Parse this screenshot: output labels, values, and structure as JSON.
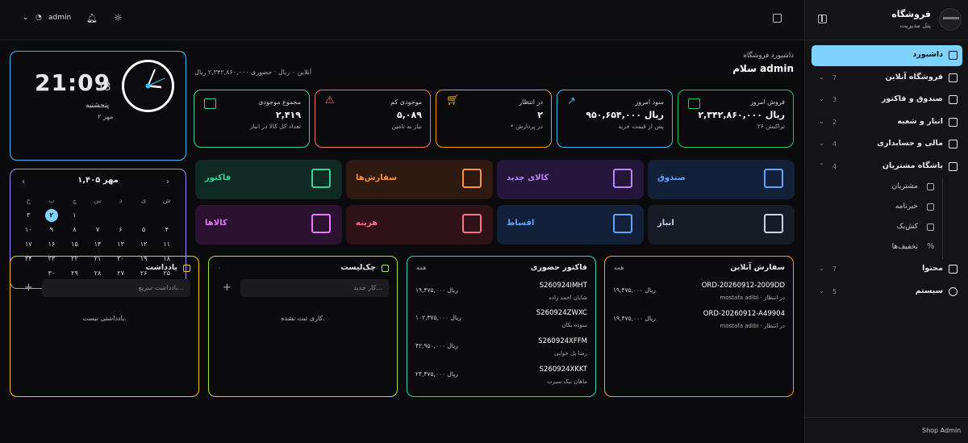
{
  "topbar": {
    "user": "admin"
  },
  "sidebar": {
    "title": "فروشگاه",
    "subtitle": "پنل مدیریت",
    "items": [
      {
        "label": "داشبورد",
        "count": "",
        "active": true
      },
      {
        "label": "فروشگاه آنلاین",
        "count": "7"
      },
      {
        "label": "صندوق و فاکتور",
        "count": "3"
      },
      {
        "label": "انبار و شعبه",
        "count": "2"
      },
      {
        "label": "مالی و حسابداری",
        "count": "4"
      },
      {
        "label": "باشگاه مشتریان",
        "count": "4"
      }
    ],
    "subitems": [
      "مشتریان",
      "خبرنامه",
      "کش‌بک",
      "تخفیف‌ها"
    ],
    "bottom_items": [
      {
        "label": "محتوا",
        "count": "7"
      },
      {
        "label": "سیستم",
        "count": "5"
      }
    ],
    "footer": "Shop Admin"
  },
  "clock": {
    "time": "21:09",
    "seconds": "13",
    "weekday": "پنجشنبه",
    "date": "۲ مهر"
  },
  "calendar": {
    "title": "مهر ۱,۴۰۵",
    "weekdays": [
      "ش",
      "ی",
      "د",
      "س",
      "چ",
      "پ",
      "ج"
    ],
    "days": [
      "",
      "",
      "",
      "",
      "۱",
      "۲",
      "۳",
      "۴",
      "۵",
      "۶",
      "۷",
      "۸",
      "۹",
      "۱۰",
      "۱۱",
      "۱۲",
      "۱۳",
      "۱۴",
      "۱۵",
      "۱۶",
      "۱۷",
      "۱۸",
      "۱۹",
      "۲۰",
      "۲۱",
      "۲۲",
      "۲۳",
      "۲۴",
      "۲۵",
      "۲۶",
      "۲۷",
      "۲۸",
      "۲۹",
      "۳۰",
      ""
    ],
    "today": "۲"
  },
  "header": {
    "breadcrumb": "داشبورد فروشگاه",
    "greeting": "سلام admin",
    "sales_line": "آنلاین ۰ ریال · حضوری ۲,۳۴۲,۸۶۰,۰۰۰ ریال"
  },
  "stats": [
    {
      "title": "فروش امروز",
      "value": "۲,۳۴۲,۸۶۰,۰۰۰ ریال",
      "sub": "۲۶ تراکنش",
      "color": "#22c55e"
    },
    {
      "title": "سود امروز",
      "value": "۹۵۰,۶۵۴,۰۰۰ ریال",
      "sub": "پس از قیمت خرید",
      "color": "#38bdf8"
    },
    {
      "title": "در انتظار",
      "value": "۲",
      "sub": "• در پردازش",
      "color": "#f59e0b"
    },
    {
      "title": "موجودی کم",
      "value": "۵,۰۸۹",
      "sub": "نیاز به تامین",
      "color": "#f87171"
    },
    {
      "title": "مجموع موجودی",
      "value": "۲,۴۱۹",
      "sub": "تعداد کل کالا در انبار",
      "color": "#34d399"
    }
  ],
  "tiles": [
    {
      "label": "صندوق",
      "color": "#60a5fa",
      "bg": "#12203a"
    },
    {
      "label": "کالای جدید",
      "color": "#c084fc",
      "bg": "#24163a"
    },
    {
      "label": "سفارش‌ها",
      "color": "#fb923c",
      "bg": "#2e1a10"
    },
    {
      "label": "فاکتور",
      "color": "#34d399",
      "bg": "#0e2a22"
    },
    {
      "label": "انبار",
      "color": "#cbd5e1",
      "bg": "#161b26"
    },
    {
      "label": "اقساط",
      "color": "#60a5fa",
      "bg": "#12203a"
    },
    {
      "label": "هزینه",
      "color": "#fb7185",
      "bg": "#2e1218"
    },
    {
      "label": "کالاها",
      "color": "#e879f9",
      "bg": "#2a1230"
    }
  ],
  "online_orders": {
    "title": "سفارش آنلاین",
    "all": "همه",
    "rows": [
      {
        "code": "ORD-20260912-2009DD",
        "name": "mostafa adibi · در انتظار",
        "amount": "۱۹,۴۷۵,۰۰۰ ریال"
      },
      {
        "code": "ORD-20260912-A49904",
        "name": "mostafa adibi · در انتظار",
        "amount": "۱۹,۴۷۵,۰۰۰ ریال"
      }
    ]
  },
  "invoices": {
    "title": "فاکتور حضوری",
    "all": "همه",
    "rows": [
      {
        "code": "S260924IMHT",
        "name": "شایان احمد زاده",
        "amount": "۱۹,۴۷۵,۰۰۰ ریال"
      },
      {
        "code": "S260924ZWXC",
        "name": "سوده بکان",
        "amount": "۱۰۲,۳۷۵,۰۰۰ ریال"
      },
      {
        "code": "S260924XFFM",
        "name": "رضا پل خوابی",
        "amount": "۴۲,۹۵۰,۰۰۰ ریال"
      },
      {
        "code": "S260924XKKT",
        "name": "ماهان نیک سیرت",
        "amount": "۲۴,۴۷۵,۰۰۰ ریال"
      }
    ]
  },
  "checklist": {
    "title": "چک‌لیست",
    "count": "۰",
    "placeholder": "کار جدید...",
    "empty": "کاری ثبت نشده."
  },
  "notes": {
    "title": "یادداشت",
    "placeholder": "یادداشت سریع...",
    "empty": "یادداشتی نیست."
  }
}
